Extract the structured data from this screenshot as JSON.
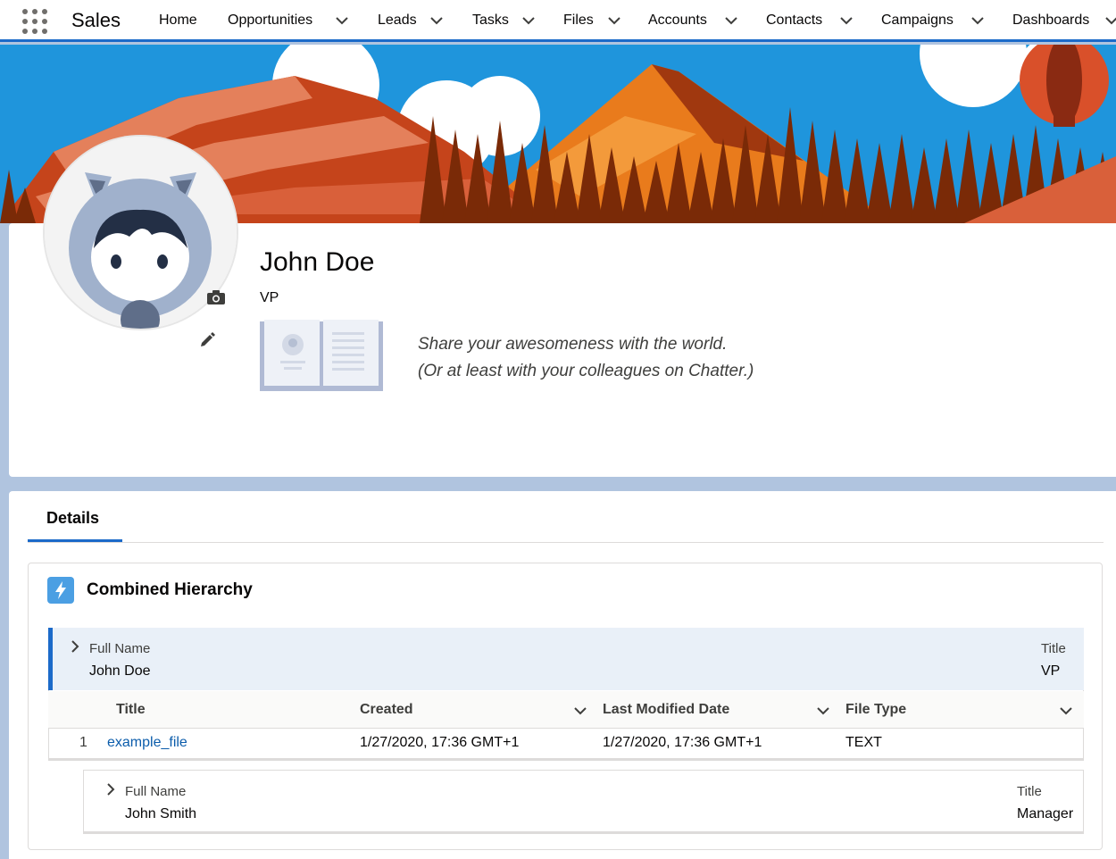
{
  "nav": {
    "app_name": "Sales",
    "items": [
      {
        "label": "Home",
        "has_menu": false
      },
      {
        "label": "Opportunities",
        "has_menu": true
      },
      {
        "label": "Leads",
        "has_menu": true
      },
      {
        "label": "Tasks",
        "has_menu": true
      },
      {
        "label": "Files",
        "has_menu": true
      },
      {
        "label": "Accounts",
        "has_menu": true
      },
      {
        "label": "Contacts",
        "has_menu": true
      },
      {
        "label": "Campaigns",
        "has_menu": true
      },
      {
        "label": "Dashboards",
        "has_menu": false
      }
    ],
    "accent_color": "#1b6ac9"
  },
  "profile": {
    "name": "John Doe",
    "title": "VP",
    "tagline_line1": "Share your awesomeness with the world.",
    "tagline_line2": "(Or at least with your colleagues on Chatter.)",
    "icons": [
      "camera-icon",
      "pencil-icon"
    ]
  },
  "details": {
    "tab_label": "Details",
    "card_title": "Combined Hierarchy",
    "card_icon": "lightning-icon",
    "root_row": {
      "full_name_label": "Full Name",
      "full_name": "John Doe",
      "title_label": "Title",
      "title": "VP"
    },
    "files_table": {
      "columns": [
        "Title",
        "Created",
        "Last Modified Date",
        "File Type"
      ],
      "rows": [
        {
          "index": "1",
          "title": "example_file",
          "created": "1/27/2020, 17:36 GMT+1",
          "modified": "1/27/2020, 17:36 GMT+1",
          "type": "TEXT"
        }
      ]
    },
    "child_row": {
      "full_name_label": "Full Name",
      "full_name": "John Smith",
      "title_label": "Title",
      "title": "Manager"
    }
  }
}
